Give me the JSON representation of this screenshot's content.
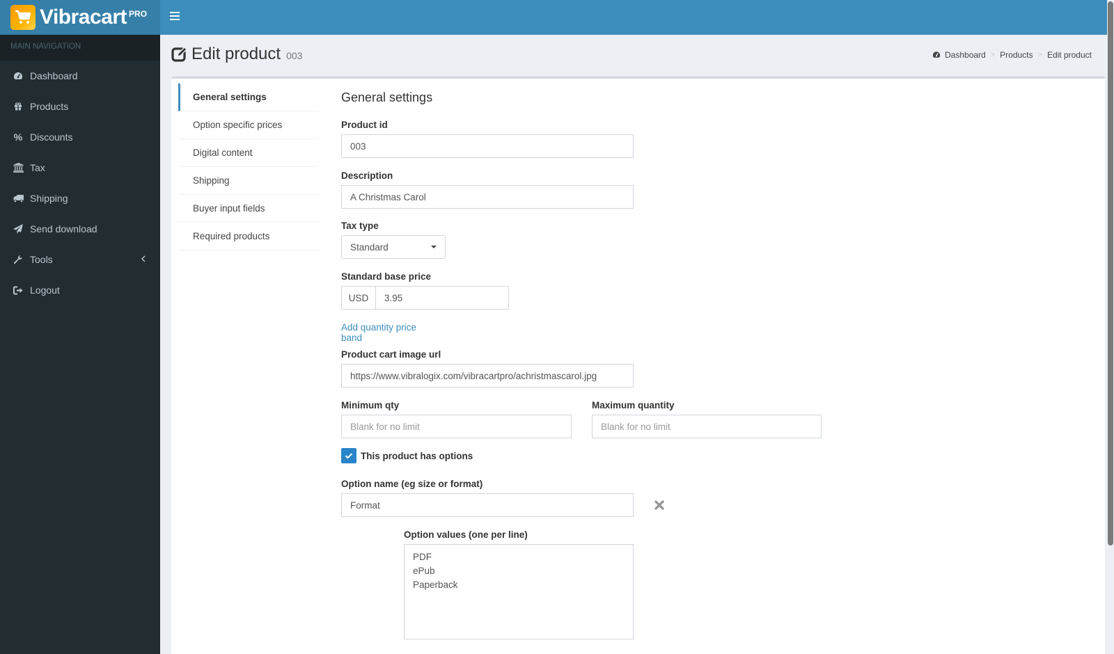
{
  "app": {
    "name": "Vibracart",
    "edition": "PRO",
    "logo_icon": "shopping-cart-icon",
    "brand_color": "#3c8dbc"
  },
  "sidebar": {
    "header": "MAIN NAVIGATION",
    "items": [
      {
        "label": "Dashboard",
        "icon": "dashboard-icon"
      },
      {
        "label": "Products",
        "icon": "gift-icon"
      },
      {
        "label": "Discounts",
        "icon": "percent-icon"
      },
      {
        "label": "Tax",
        "icon": "bank-icon"
      },
      {
        "label": "Shipping",
        "icon": "truck-icon"
      },
      {
        "label": "Send download",
        "icon": "paper-plane-icon"
      },
      {
        "label": "Tools",
        "icon": "wrench-icon",
        "has_submenu": true
      },
      {
        "label": "Logout",
        "icon": "sign-out-icon"
      }
    ]
  },
  "page": {
    "title": "Edit product",
    "subtitle": "003",
    "breadcrumb": [
      "Dashboard",
      "Products",
      "Edit product"
    ]
  },
  "tabs": [
    {
      "label": "General settings",
      "active": true
    },
    {
      "label": "Option specific prices"
    },
    {
      "label": "Digital content"
    },
    {
      "label": "Shipping"
    },
    {
      "label": "Buyer input fields"
    },
    {
      "label": "Required products"
    }
  ],
  "form": {
    "section_title": "General settings",
    "product_id": {
      "label": "Product id",
      "value": "003"
    },
    "description": {
      "label": "Description",
      "value": "A Christmas Carol"
    },
    "tax_type": {
      "label": "Tax type",
      "value": "Standard"
    },
    "base_price": {
      "label": "Standard base price",
      "currency": "USD",
      "value": "3.95"
    },
    "add_price_band_link": "Add quantity price band",
    "image_url": {
      "label": "Product cart image url",
      "value": "https://www.vibralogix.com/vibracartpro/achristmascarol.jpg"
    },
    "min_qty": {
      "label": "Minimum qty",
      "value": "",
      "placeholder": "Blank for no limit"
    },
    "max_qty": {
      "label": "Maximum quantity",
      "value": "",
      "placeholder": "Blank for no limit"
    },
    "has_options": {
      "label": "This product has options",
      "checked": true
    },
    "option_name": {
      "label": "Option name (eg size or format)",
      "value": "Format"
    },
    "option_values": {
      "label": "Option values (one per line)",
      "value": "PDF\nePub\nPaperback"
    }
  }
}
